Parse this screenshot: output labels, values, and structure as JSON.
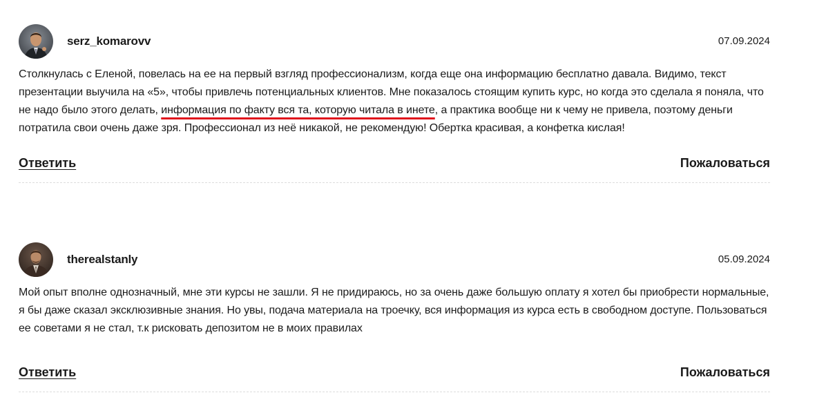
{
  "comments": [
    {
      "username": "serz_komarovv",
      "date": "07.09.2024",
      "text_before": "Столкнулась с Еленой, повелась на ее на первый взгляд профессионализм, когда еще она информацию бесплатно давала. Видимо, текст презентации выучила на «5», чтобы привлечь потенциальных клиентов. Мне показалось стоящим купить курс, но когда это сделала я поняла, что не надо было этого делать, ",
      "text_highlight": "информация по факту вся та, которую читала в инете",
      "text_after": ", а практика вообще ни к чему не привела, поэтому деньги потратила свои очень даже зря. Профессионал из неё никакой, не рекомендую! Обертка красивая, а конфетка кислая!",
      "reply_label": "Ответить",
      "report_label": "Пожаловаться"
    },
    {
      "username": "therealstanly",
      "date": "05.09.2024",
      "text": "Мой опыт вполне однозначный, мне эти курсы не зашли. Я не придираюсь, но за очень даже большую оплату я хотел бы приобрести нормальные, я бы даже сказал эксклюзивные знания. Но увы, подача материала на троечку, вся информация из курса есть в свободном доступе. Пользоваться ее советами я не стал, т.к рисковать депозитом не в моих правилах",
      "reply_label": "Ответить",
      "report_label": "Пожаловаться"
    }
  ],
  "colors": {
    "text": "#1a1a1a",
    "highlight_underline": "#e0111b",
    "divider": "#dcdcdc"
  }
}
